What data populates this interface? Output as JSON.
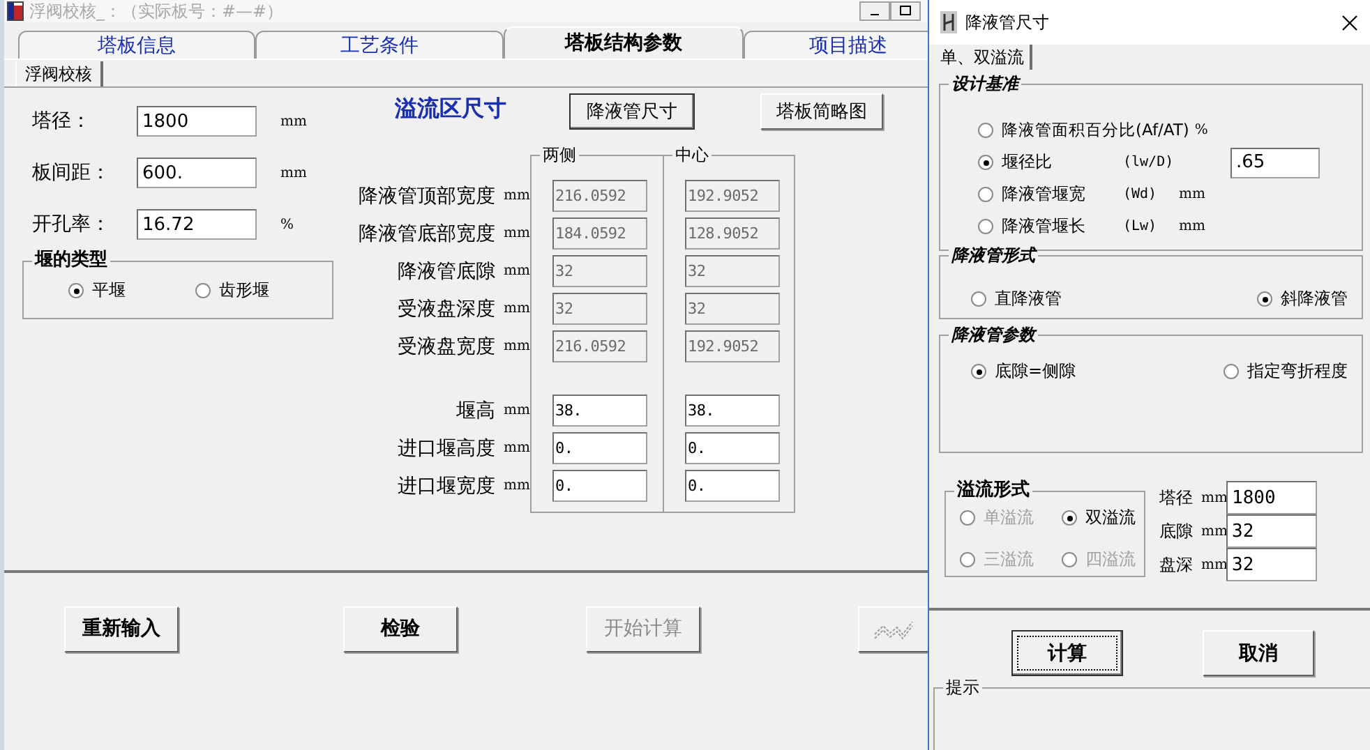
{
  "main_window": {
    "title": "浮阀校核_：（实际板号：#—#）",
    "tabs": [
      {
        "label": "塔板信息",
        "selected": false
      },
      {
        "label": "工艺条件",
        "selected": false
      },
      {
        "label": "塔板结构参数",
        "selected": true
      },
      {
        "label": "项目描述",
        "selected": false
      }
    ],
    "subtab": "浮阀校核",
    "basic_fields": [
      {
        "label": "塔径：",
        "value": "1800",
        "unit": "mm"
      },
      {
        "label": "板间距：",
        "value": "600.",
        "unit": "mm"
      },
      {
        "label": "开孔率：",
        "value": "16.72",
        "unit": "%"
      }
    ],
    "weir_type": {
      "title": "堰的类型",
      "options": [
        {
          "label": "平堰",
          "selected": true
        },
        {
          "label": "齿形堰",
          "selected": false
        }
      ]
    },
    "overflow": {
      "title": "溢流区尺寸",
      "buttons": [
        {
          "label": "降液管尺寸",
          "default": true
        },
        {
          "label": "塔板简略图",
          "default": false
        }
      ],
      "columns": [
        "两侧",
        "中心"
      ],
      "rows": [
        {
          "label": "降液管顶部宽度",
          "unit": "mm",
          "values": [
            {
              "value": "216.0592",
              "readonly": true
            },
            {
              "value": "192.9052",
              "readonly": true
            }
          ]
        },
        {
          "label": "降液管底部宽度",
          "unit": "mm",
          "values": [
            {
              "value": "184.0592",
              "readonly": true
            },
            {
              "value": "128.9052",
              "readonly": true
            }
          ]
        },
        {
          "label": "降液管底隙",
          "unit": "mm",
          "values": [
            {
              "value": "32",
              "readonly": true
            },
            {
              "value": "32",
              "readonly": true
            }
          ]
        },
        {
          "label": "受液盘深度",
          "unit": "mm",
          "values": [
            {
              "value": "32",
              "readonly": true
            },
            {
              "value": "32",
              "readonly": true
            }
          ]
        },
        {
          "label": "受液盘宽度",
          "unit": "mm",
          "values": [
            {
              "value": "216.0592",
              "readonly": true
            },
            {
              "value": "192.9052",
              "readonly": true
            }
          ]
        },
        {
          "label": "堰高",
          "unit": "mm",
          "values": [
            {
              "value": "38.",
              "readonly": false
            },
            {
              "value": "38.",
              "readonly": false
            }
          ]
        },
        {
          "label": "进口堰高度",
          "unit": "mm",
          "values": [
            {
              "value": "0.",
              "readonly": false
            },
            {
              "value": "0.",
              "readonly": false
            }
          ]
        },
        {
          "label": "进口堰宽度",
          "unit": "mm",
          "values": [
            {
              "value": "0.",
              "readonly": false
            },
            {
              "value": "0.",
              "readonly": false
            }
          ]
        }
      ]
    },
    "buttons": [
      {
        "kind": "text",
        "label": "重新输入",
        "disabled": false
      },
      {
        "kind": "text",
        "label": "检验",
        "disabled": false
      },
      {
        "kind": "text",
        "label": "开始计算",
        "disabled": true
      },
      {
        "kind": "chart",
        "disabled": true
      }
    ]
  },
  "dialog": {
    "title": "降液管尺寸",
    "tab": "单、双溢流",
    "design_basis": {
      "title": "设计基准",
      "options": [
        {
          "label": "降液管面积百分比(Af/AT)",
          "unit": "%",
          "selected": false
        },
        {
          "label": "堰径比",
          "symbol": "(lw/D)",
          "selected": true,
          "value": ".65"
        },
        {
          "label": "降液管堰宽",
          "symbol": "(Wd)",
          "unit": "mm",
          "selected": false
        },
        {
          "label": "降液管堰长",
          "symbol": "(Lw)",
          "unit": "mm",
          "selected": false
        }
      ]
    },
    "downcomer_form": {
      "title": "降液管形式",
      "options": [
        {
          "label": "直降液管",
          "selected": false
        },
        {
          "label": "斜降液管",
          "selected": true
        }
      ]
    },
    "downcomer_params": {
      "title": "降液管参数",
      "options": [
        {
          "label": "底隙=侧隙",
          "selected": true
        },
        {
          "label": "指定弯折程度",
          "selected": false
        }
      ]
    },
    "overflow_form": {
      "title": "溢流形式",
      "options": [
        {
          "label": "单溢流",
          "selected": false,
          "disabled": true
        },
        {
          "label": "双溢流",
          "selected": true,
          "disabled": false
        },
        {
          "label": "三溢流",
          "selected": false,
          "disabled": true
        },
        {
          "label": "四溢流",
          "selected": false,
          "disabled": true
        }
      ]
    },
    "fields": [
      {
        "label": "塔径",
        "unit": "mm",
        "value": "1800"
      },
      {
        "label": "底隙",
        "unit": "mm",
        "value": "32"
      },
      {
        "label": "盘深",
        "unit": "mm",
        "value": "32"
      }
    ],
    "buttons": [
      {
        "label": "计算",
        "default": true
      },
      {
        "label": "取消",
        "default": false
      }
    ],
    "hint": {
      "title": "提示"
    }
  }
}
